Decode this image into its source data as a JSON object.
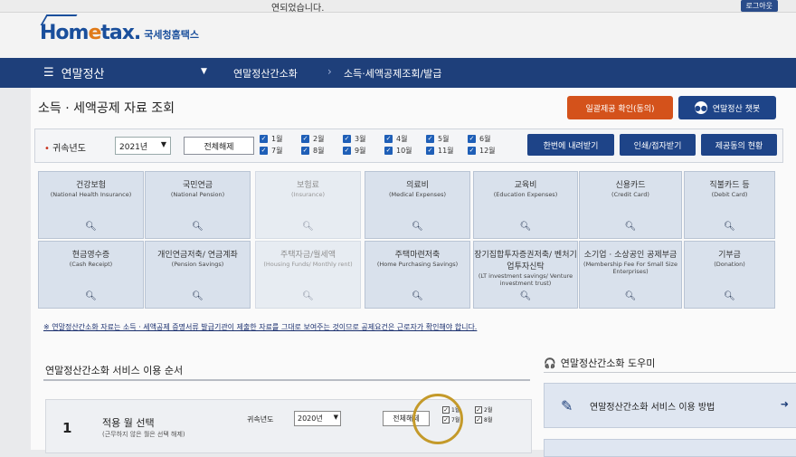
{
  "top": {
    "message": "연되었습니다.",
    "logout": "로그아웃"
  },
  "logo": {
    "mark_a": "Hom",
    "mark_e": "e",
    "mark_b": "tax.",
    "sub": "국세청홈택스"
  },
  "nav": {
    "menu": "연말정산",
    "crumb1": "연말정산간소화",
    "crumb2": "소득·세액공제조회/발급"
  },
  "page": {
    "title": "소득 · 세액공제 자료 조회",
    "btn_consent": "일괄제공 확인(동의)",
    "btn_chatbot": "연말정산 챗봇",
    "chatbot_icon_text": "●●"
  },
  "filter": {
    "label": "귀속년도",
    "year": "2021년",
    "btn_cancel_all": "전체해제",
    "months": [
      "1월",
      "2월",
      "3월",
      "4월",
      "5월",
      "6월",
      "7월",
      "8월",
      "9월",
      "10월",
      "11월",
      "12월"
    ],
    "btn_download": "한번에 내려받기",
    "btn_print": "인쇄/접자받기",
    "btn_consent_status": "제공동의 현황"
  },
  "tiles": [
    {
      "k": "건강보험",
      "e": "(National Health Insurance)"
    },
    {
      "k": "국민연금",
      "e": "(National Pension)"
    },
    {
      "k": "보험료",
      "e": "(Insurance)"
    },
    {
      "k": "의료비",
      "e": "(Medical Expenses)"
    },
    {
      "k": "교육비",
      "e": "(Education Expenses)"
    },
    {
      "k": "신용카드",
      "e": "(Credit Card)"
    },
    {
      "k": "직불카드 등",
      "e": "(Debit Card)"
    },
    {
      "k": "현금영수증",
      "e": "(Cash Receipt)"
    },
    {
      "k": "개인연금저축/ 연금계좌",
      "e": "(Pension Savings)"
    },
    {
      "k": "주택자금/월세액",
      "e": "(Housing Funds/ Monthly rent)"
    },
    {
      "k": "주택마련저축",
      "e": "(Home Purchasing Savings)"
    },
    {
      "k": "장기집합투자증권저축/ 벤처기업투자신탁",
      "e": "(LT investment savings/ Venture investment trust)"
    },
    {
      "k": "소기업 · 소상공인 공제부금",
      "e": "(Membership Fee For Small Size Enterprises)"
    },
    {
      "k": "기부금",
      "e": "(Donation)"
    }
  ],
  "notice": "※ 연말정산간소화 자료는 소득 · 세액공제 증명서류 발급기관이 제출한 자료를 그대로 보여주는 것이므로 공제요건은 근로자가 확인해야 합니다.",
  "process": {
    "title": "연말정산간소화 서비스 이용 순서",
    "step_num": "1",
    "step_title": "적용 월 선택",
    "step_sub": "(근무하지 않은 월은 선택 해제)",
    "year_label": "귀속년도",
    "year": "2020년",
    "btn_all": "전체해제",
    "m1": [
      "1월",
      "7월"
    ],
    "m2": [
      "2월",
      "8월"
    ]
  },
  "helper": {
    "title": "연말정산간소화 도우미",
    "card_text": "연말정산간소화 서비스 이용 방법"
  }
}
